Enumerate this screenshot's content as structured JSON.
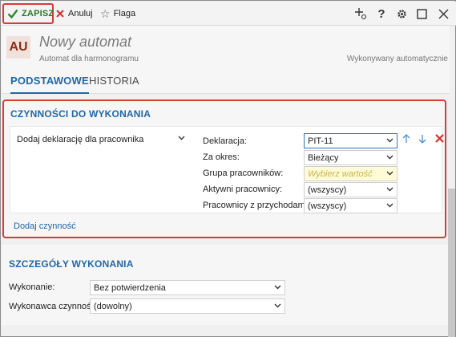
{
  "toolbar": {
    "save_label": "ZAPISZ",
    "cancel_label": "Anuluj",
    "flag_label": "Flaga"
  },
  "header": {
    "avatar": "AU",
    "title": "Nowy automat",
    "subtitle": "Automat dla harmonogramu",
    "status": "Wykonywany automatycznie"
  },
  "tabs": [
    "PODSTAWOWE",
    "HISTORIA"
  ],
  "tasks_section": {
    "title": "CZYNNOŚCI DO WYKONANIA",
    "task": "Dodaj deklarację dla pracownika",
    "fields": [
      {
        "label": "Deklaracja:",
        "value": "PIT-11"
      },
      {
        "label": "Za okres:",
        "value": "Bieżący"
      },
      {
        "label": "Grupa pracowników:",
        "value": "Wybierz wartość"
      },
      {
        "label": "Aktywni pracownicy:",
        "value": "(wszyscy)"
      },
      {
        "label": "Pracownicy z przychodami:",
        "value": "(wszyscy)"
      }
    ],
    "add_label": "Dodaj czynność"
  },
  "details_section": {
    "title": "SZCZEGÓŁY WYKONANIA",
    "fields": [
      {
        "label": "Wykonanie:",
        "value": "Bez potwierdzenia"
      },
      {
        "label": "Wykonawca czynności:",
        "value": "(dowolny)"
      }
    ]
  },
  "colors": {
    "accent": "#2167a8",
    "highlight_border": "#d93a3a",
    "save_green": "#2a7a2a",
    "delete_red": "#d32f2f"
  }
}
